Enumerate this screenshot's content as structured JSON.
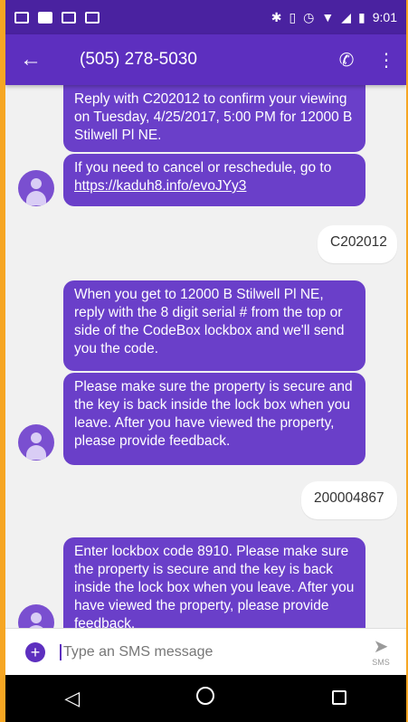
{
  "status_bar": {
    "time": "9:01"
  },
  "toolbar": {
    "title": "(505) 278-5030"
  },
  "icons": {
    "back": "arrow-left-icon",
    "call": "phone-icon",
    "menu": "more-vert-icon",
    "add": "plus-circle-icon",
    "send": "send-icon",
    "nav_back": "triangle-back-icon",
    "nav_home": "circle-home-icon",
    "nav_recents": "square-recents-icon"
  },
  "colors": {
    "accent": "#5d2fbf",
    "bubble": "#6a3fc9",
    "status": "#4a22a0",
    "frame": "#F6A623"
  },
  "messages": [
    {
      "text": "Reply with C202012 to confirm your viewing on Tuesday, 4/25/2017, 5:00 PM for 12000 B Stilwell Pl NE."
    },
    {
      "text": "If you need to cancel or reschedule, go to ",
      "link": "https://kaduh8.info/evoJYy3"
    },
    {
      "text": "C202012"
    },
    {
      "text": "When you get to 12000 B Stilwell Pl NE, reply with the 8 digit serial # from the top or side of the CodeBox lockbox and we'll send you the code."
    },
    {
      "text": "Please make sure the property is secure and the key is back inside the lock box when you leave. After you have viewed the property, please provide feedback."
    },
    {
      "text": "200004867"
    },
    {
      "text": "Enter lockbox code 8910.  Please make sure the property is secure and the key is back inside the lock box when you leave. After you have viewed the property, please provide feedback."
    }
  ],
  "compose": {
    "placeholder": "Type an SMS message",
    "send_label": "SMS"
  }
}
